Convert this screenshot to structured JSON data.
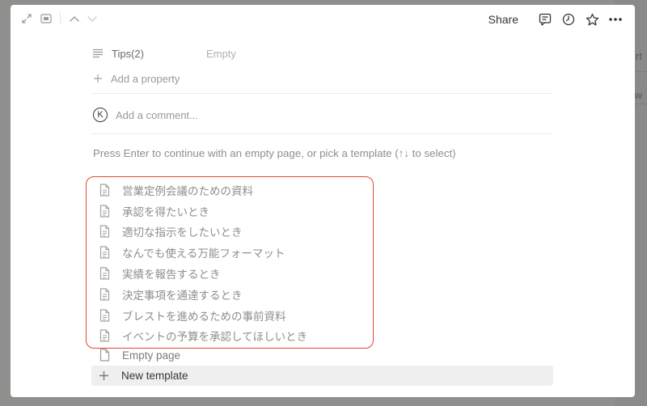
{
  "background": {
    "partial_texts": [
      "rt",
      "w"
    ]
  },
  "topbar": {
    "share_label": "Share",
    "left_icons": [
      "expand-icon",
      "sidepeek-icon",
      "chevron-up-icon",
      "chevron-down-icon"
    ],
    "right_icons": [
      "comment-icon",
      "clock-icon",
      "star-icon",
      "more-icon"
    ]
  },
  "properties": [
    {
      "icon": "text-lines-icon",
      "name": "Tips(2)",
      "value": "Empty"
    }
  ],
  "add_property_label": "Add a property",
  "comment": {
    "avatar_letter": "K",
    "placeholder": "Add a comment..."
  },
  "prompt_text": "Press Enter to continue with an empty page, or pick a template (↑↓ to select)",
  "templates": [
    {
      "label": "営業定例会議のための資料"
    },
    {
      "label": "承認を得たいとき"
    },
    {
      "label": "適切な指示をしたいとき"
    },
    {
      "label": "なんでも使える万能フォーマット"
    },
    {
      "label": "実績を報告するとき"
    },
    {
      "label": "決定事項を通達するとき"
    },
    {
      "label": "ブレストを進めるための事前資料"
    },
    {
      "label": "イベントの予算を承認してほしいとき"
    }
  ],
  "empty_page_label": "Empty page",
  "new_template_label": "New template",
  "colors": {
    "highlight_border": "#e0462f",
    "overlay": "#8f8f8e",
    "text_primary": "#37352f",
    "text_muted": "#8f8e8a"
  }
}
